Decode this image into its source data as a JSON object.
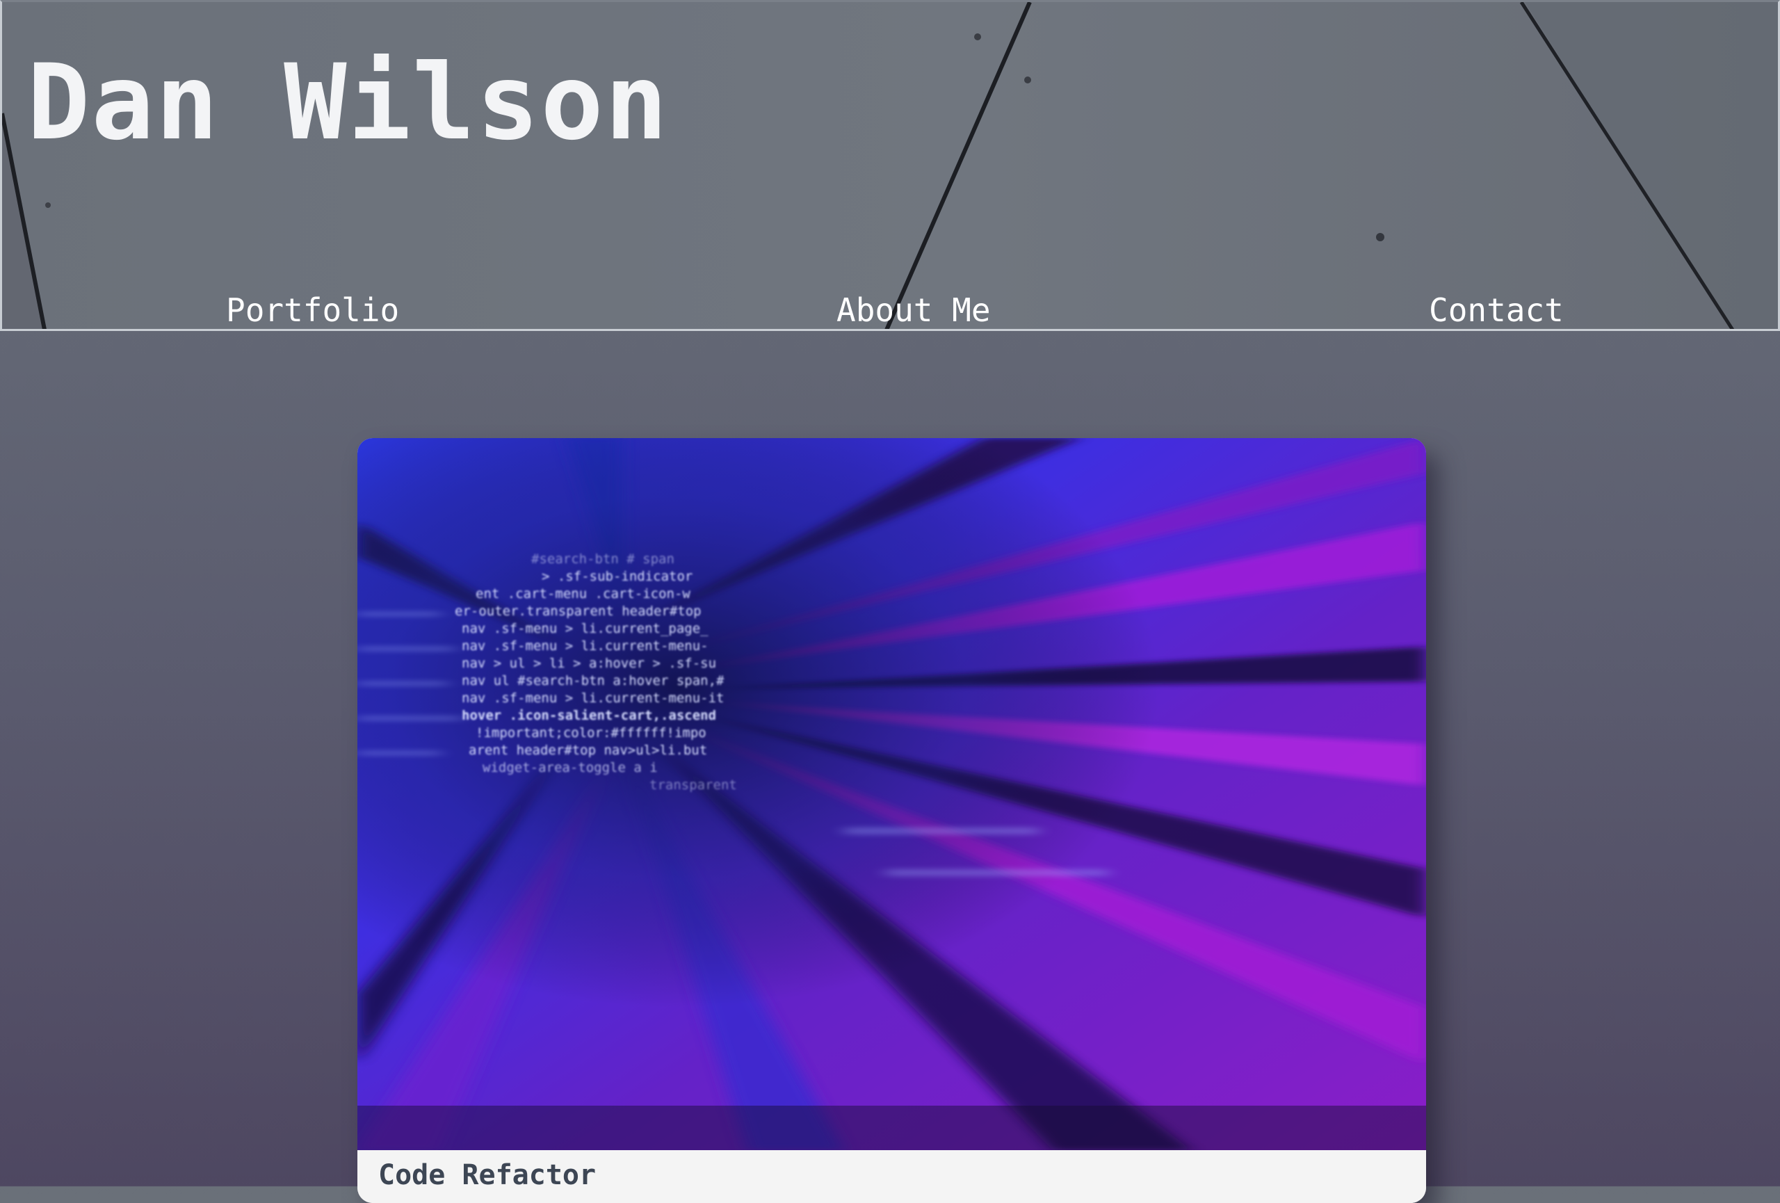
{
  "header": {
    "title": "Dan Wilson",
    "nav": [
      {
        "label": "Portfolio"
      },
      {
        "label": "About Me"
      },
      {
        "label": "Contact"
      }
    ]
  },
  "projects": [
    {
      "title": "Code Refactor",
      "image_icon": "code-screen-image",
      "code_lines": [
        "#search-btn # span",
        "> .sf-sub-indicator",
        "ent .cart-menu .cart-icon-w",
        "er-outer.transparent header#top",
        "nav .sf-menu > li.current_page_",
        "nav .sf-menu > li.current-menu-",
        "nav > ul > li > a:hover > .sf-su",
        "nav ul #search-btn a:hover span,#",
        "nav .sf-menu > li.current-menu-it",
        "hover .icon-salient-cart,.ascend",
        "!important;color:#ffffff!impo",
        "arent header#top nav>ul>li.but",
        "widget-area-toggle a i",
        "transparent"
      ]
    }
  ],
  "colors": {
    "header_text": "#f3f4f6",
    "nav_text": "#ffffff",
    "card_caption_bg": "#f4f4f4",
    "card_title_text": "#3d4654",
    "image_blue": "#2b36e0",
    "image_purple": "#8a1ec8"
  }
}
